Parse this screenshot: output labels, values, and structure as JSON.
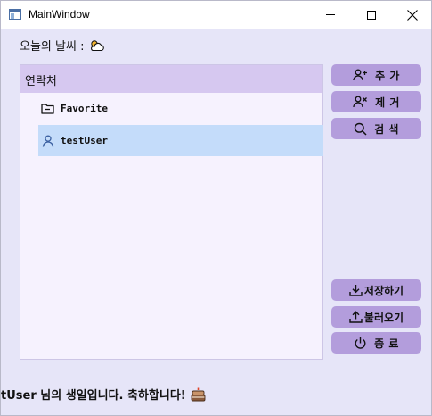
{
  "window": {
    "title": "MainWindow"
  },
  "weather": {
    "label": "오늘의 날씨 :",
    "icon": "cloud-sun-icon"
  },
  "contacts": {
    "header": "연락처",
    "items": [
      {
        "label": "Favorite",
        "icon": "folder-icon"
      },
      {
        "label": "testUser",
        "icon": "user-icon",
        "selected": true
      }
    ]
  },
  "buttons": {
    "add": "추 가",
    "remove": "제 거",
    "search": "검 색",
    "save": "저장하기",
    "load": "불러오기",
    "exit": "종 료"
  },
  "status": {
    "birthday_message": "tUser 님의 생일입니다. 축하합니다!",
    "icon": "cake-icon"
  },
  "colors": {
    "window_bg": "#e6e5f8",
    "button_bg": "#b39ddc",
    "header_bg": "#d6c8f0",
    "selection_bg": "#c4dcfa"
  }
}
